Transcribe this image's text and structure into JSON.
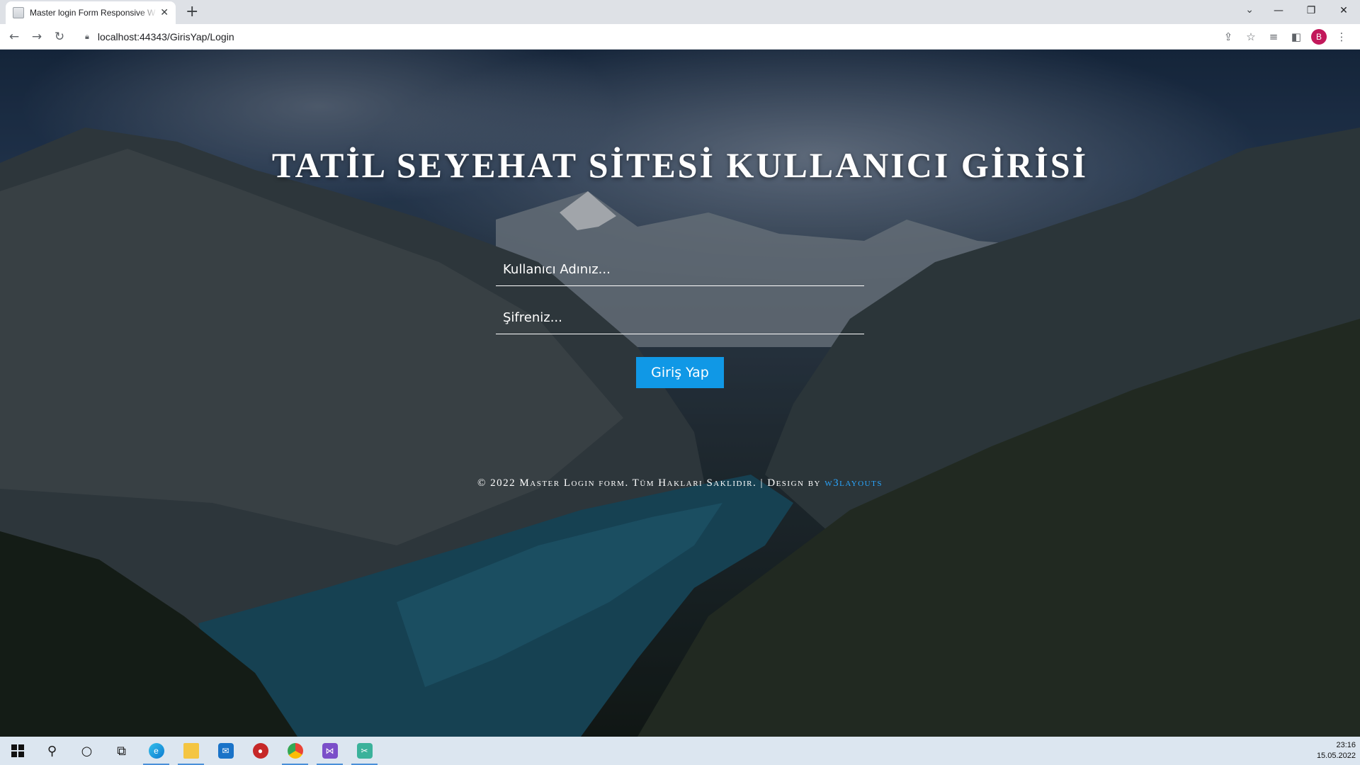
{
  "browser": {
    "tab_title": "Master login Form Responsive W",
    "url": "localhost:44343/GirisYap/Login",
    "profile_initial": "B",
    "new_tab_label": "+",
    "icons": [
      "back-icon",
      "forward-icon",
      "reload-icon",
      "lock-icon",
      "share-icon",
      "star-icon",
      "reading-list-icon",
      "side-panel-icon",
      "menu-icon"
    ]
  },
  "page": {
    "title": "TATİL SEYEHAT SİTESİ KULLANICI GİRİSİ",
    "username_placeholder": "Kullanıcı Adınız...",
    "password_placeholder": "Şifreniz...",
    "login_button": "Giriş Yap",
    "footer_text": "© 2022 Master Login form. Tüm Hakları Saklıdır. | Design by ",
    "footer_link": "w3layouts",
    "button_color": "#1098e6",
    "link_color": "#2aa6ff"
  },
  "taskbar": {
    "time": "23:16",
    "date": "15.05.2022",
    "apps": [
      "start-icon",
      "search-icon",
      "cortana-icon",
      "task-view-icon",
      "edge-icon",
      "file-explorer-icon",
      "mail-icon",
      "media-app-icon",
      "chrome-icon",
      "visual-studio-icon",
      "snipping-tool-icon"
    ]
  }
}
